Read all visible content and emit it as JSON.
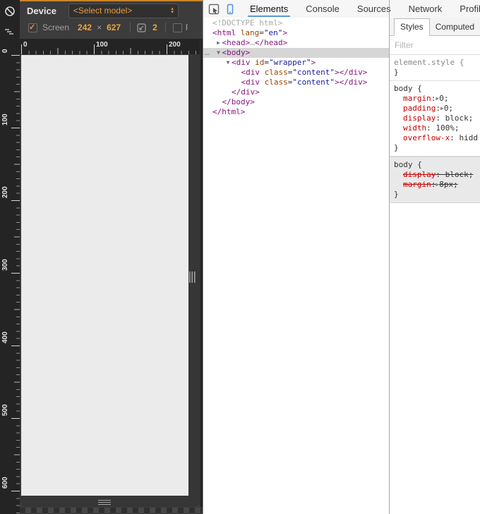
{
  "colors": {
    "accent_orange": "#ec9b38",
    "panel_dark": "#3c3c3c",
    "devtools_active_blue": "#5b9bd3",
    "device_icon_blue": "#4e90e2",
    "tag_purple": "#881280",
    "attr_name_brown": "#994500",
    "attr_value_blue": "#1a1aa6",
    "property_red": "#c80000",
    "selection_gray": "#d6d6d6",
    "screen_gray": "#ebebeb"
  },
  "left_toolbar": {
    "block_icon": "no-overrides-icon",
    "cascade_icon": "network-conditions-icon"
  },
  "device_toolbar": {
    "device_label": "Device",
    "model_select_value": "<Select model>",
    "screen_checkbox_checked": true,
    "screen_label": "Screen",
    "screen_width": "242",
    "times": "×",
    "screen_height": "627",
    "dpr_value": "2",
    "fit_checkbox_checked": false,
    "fit_label_clipped": "F"
  },
  "rulers": {
    "horizontal_labels": [
      "0",
      "100",
      "200"
    ],
    "vertical_labels": [
      "0",
      "100",
      "200",
      "300",
      "400",
      "500",
      "600"
    ]
  },
  "devtools_toolbar": {
    "tabs": [
      "Elements",
      "Console",
      "Sources",
      "Network",
      "Profiles"
    ],
    "active_tab": "Elements"
  },
  "elements_tree": {
    "rows": [
      {
        "indent": 0,
        "arrow": null,
        "selected": false,
        "dots": false,
        "segs": [
          [
            "gray",
            "<!DOCTYPE html>"
          ]
        ]
      },
      {
        "indent": 0,
        "arrow": null,
        "selected": false,
        "dots": false,
        "segs": [
          [
            "tag",
            "<html "
          ],
          [
            "attr",
            "lang"
          ],
          [
            "plain",
            "="
          ],
          [
            "val",
            "\"en\""
          ],
          [
            "tag",
            ">"
          ]
        ]
      },
      {
        "indent": 1,
        "arrow": "r",
        "selected": false,
        "dots": false,
        "segs": [
          [
            "tag",
            "<head>"
          ],
          [
            "gray",
            "…"
          ],
          [
            "tag",
            "</head>"
          ]
        ]
      },
      {
        "indent": 1,
        "arrow": "v",
        "selected": true,
        "dots": true,
        "segs": [
          [
            "tag",
            "<body>"
          ]
        ]
      },
      {
        "indent": 2,
        "arrow": "v",
        "selected": false,
        "dots": false,
        "segs": [
          [
            "tag",
            "<div "
          ],
          [
            "attr",
            "id"
          ],
          [
            "plain",
            "="
          ],
          [
            "val",
            "\"wrapper\""
          ],
          [
            "tag",
            ">"
          ]
        ]
      },
      {
        "indent": 3,
        "arrow": null,
        "selected": false,
        "dots": false,
        "segs": [
          [
            "tag",
            "<div "
          ],
          [
            "attr",
            "class"
          ],
          [
            "plain",
            "="
          ],
          [
            "val",
            "\"content\""
          ],
          [
            "tag",
            "></div>"
          ]
        ]
      },
      {
        "indent": 3,
        "arrow": null,
        "selected": false,
        "dots": false,
        "segs": [
          [
            "tag",
            "<div "
          ],
          [
            "attr",
            "class"
          ],
          [
            "plain",
            "="
          ],
          [
            "val",
            "\"content\""
          ],
          [
            "tag",
            "></div>"
          ]
        ]
      },
      {
        "indent": 2,
        "arrow": null,
        "selected": false,
        "dots": false,
        "segs": [
          [
            "tag",
            "</div>"
          ]
        ]
      },
      {
        "indent": 1,
        "arrow": null,
        "selected": false,
        "dots": false,
        "segs": [
          [
            "tag",
            "</body>"
          ]
        ]
      },
      {
        "indent": 0,
        "arrow": null,
        "selected": false,
        "dots": false,
        "segs": [
          [
            "tag",
            "</html>"
          ]
        ]
      }
    ]
  },
  "styles_sidebar": {
    "tabs": [
      "Styles",
      "Computed",
      "E"
    ],
    "active_tab": "Styles",
    "filter_placeholder": "Filter",
    "blocks": [
      {
        "bg": "white",
        "lines": [
          {
            "ind": 0,
            "strike": false,
            "segs": [
              [
                "sel",
                "element.style {"
              ]
            ]
          },
          {
            "ind": 0,
            "strike": false,
            "segs": [
              [
                "plain",
                "}"
              ]
            ]
          }
        ]
      },
      {
        "bg": "white",
        "lines": [
          {
            "ind": 0,
            "strike": false,
            "segs": [
              [
                "plain",
                "body {"
              ]
            ]
          },
          {
            "ind": 1,
            "strike": false,
            "segs": [
              [
                "prop",
                "margin"
              ],
              [
                "plain",
                ":"
              ],
              [
                "tri",
                "▶"
              ],
              [
                "val",
                "0;"
              ]
            ]
          },
          {
            "ind": 1,
            "strike": false,
            "segs": [
              [
                "prop",
                "padding"
              ],
              [
                "plain",
                ":"
              ],
              [
                "tri",
                "▶"
              ],
              [
                "val",
                "0;"
              ]
            ]
          },
          {
            "ind": 1,
            "strike": false,
            "segs": [
              [
                "prop",
                "display"
              ],
              [
                "plain",
                ": "
              ],
              [
                "val",
                "block;"
              ]
            ]
          },
          {
            "ind": 1,
            "strike": false,
            "segs": [
              [
                "prop",
                "width"
              ],
              [
                "plain",
                ": "
              ],
              [
                "val",
                "100%;"
              ]
            ]
          },
          {
            "ind": 1,
            "strike": false,
            "segs": [
              [
                "prop",
                "overflow-x"
              ],
              [
                "plain",
                ": "
              ],
              [
                "val",
                "hidd"
              ]
            ]
          },
          {
            "ind": 0,
            "strike": false,
            "segs": [
              [
                "plain",
                "}"
              ]
            ]
          }
        ]
      },
      {
        "bg": "gray",
        "lines": [
          {
            "ind": 0,
            "strike": false,
            "segs": [
              [
                "plain",
                "body {"
              ]
            ]
          },
          {
            "ind": 1,
            "strike": true,
            "segs": [
              [
                "prop",
                "display"
              ],
              [
                "plain",
                ": "
              ],
              [
                "val",
                "block;"
              ]
            ]
          },
          {
            "ind": 1,
            "strike": true,
            "segs": [
              [
                "prop",
                "margin"
              ],
              [
                "plain",
                ":"
              ],
              [
                "tri",
                "▶"
              ],
              [
                "val",
                "8px;"
              ]
            ]
          },
          {
            "ind": 0,
            "strike": false,
            "segs": [
              [
                "plain",
                "}"
              ]
            ]
          }
        ]
      }
    ]
  }
}
